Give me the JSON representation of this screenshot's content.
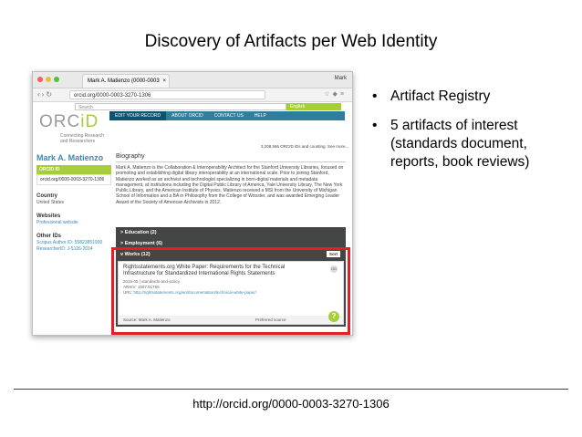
{
  "slide": {
    "title": "Discovery of Artifacts per Web Identity",
    "bullets": [
      "Artifact Registry",
      "5 artifacts of interest (standards document, reports, book reviews)"
    ],
    "footer_url": "http://orcid.org/0000-0003-3270-1306",
    "highlight_color": "#e31e24"
  },
  "browser": {
    "tab_title": "Mark A. Matienzo (0000-0003",
    "user": "Mark",
    "url": "orcid.org/0000-0003-3270-1306"
  },
  "orcid": {
    "search_placeholder": "Search",
    "search_button": "English",
    "logo_gray": "ORC",
    "logo_green": "iD",
    "tagline": "Connecting Research and Researchers",
    "nav": [
      "EDIT YOUR RECORD",
      "ABOUT ORCID",
      "CONTACT US",
      "HELP"
    ],
    "count_text": "3,208,566 ORCID iDs and counting. See more...",
    "brand_green": "#a6ce39",
    "brand_blue": "#2e7f9f",
    "person_name": "Mark A. Matienzo",
    "id_label": "ORCID ID",
    "id_url": "orcid.org/0000-0003-3270-1306",
    "country_label": "Country",
    "country_value": "United States",
    "websites_label": "Websites",
    "website_value": "Professional website",
    "other_ids_label": "Other IDs",
    "other_ids": [
      "Scopus Author ID: 55823851900",
      "ResearcherID: J-5126-2014"
    ],
    "biography_label": "Biography",
    "biography_text": "Mark A. Matienzo is the Collaboration & Interoperability Architect for the Stanford University Libraries, focused on promoting and establishing digital library interoperability at an international scale. Prior to joining Stanford, Matienzo worked as an archivist and technologist specializing in born-digital materials and metadata management, at institutions including the Digital Public Library of America, Yale University Library, The New York Public Library, and the American Institute of Physics. Matienzo received a MSI from the University of Michigan School of Information and a BA in Philosophy from the College of Wooster, and was awarded Emerging Leader Award of the Society of American Archivists in 2012.",
    "sections": [
      "> Education (2)",
      "> Employment (6)"
    ],
    "works_label": "v Works (12)",
    "sort_label": "Sort",
    "work": {
      "title": "Rightsstatements.org White Paper: Requirements for the Technical Infrastructure for Standardized International Rights Statements",
      "year_type": "2015-05 | standards-and-policy",
      "arxiv": "ARXIV: 1507.01765",
      "url_label": "URL:",
      "url": "http://rightsstatements.org/en/documentation/technical-white-paper/",
      "source": "Source: Mark A. Matienzo",
      "preferred": "Preferred source",
      "view_label": "OG"
    },
    "help_label": "?"
  }
}
